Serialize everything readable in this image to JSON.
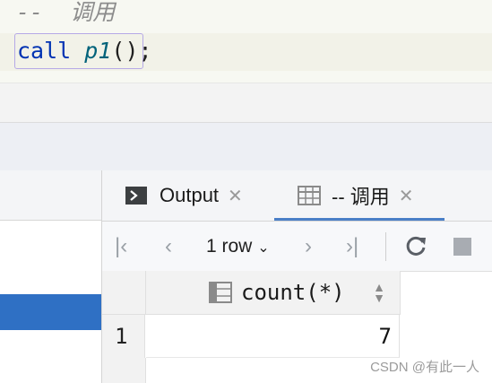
{
  "editor": {
    "comment_line": "--  调用",
    "keyword": "call",
    "proc_name": "p1",
    "punct": "();"
  },
  "results": {
    "tabs": [
      {
        "label": "Output",
        "icon": "console-icon"
      },
      {
        "label": "-- 调用",
        "icon": "table-icon",
        "active": true
      }
    ],
    "toolbar": {
      "rows_label": "1 row",
      "buttons": [
        "first-page-icon",
        "previous-page-icon",
        "next-page-icon",
        "last-page-icon",
        "refresh-icon",
        "stop-icon"
      ]
    },
    "grid": {
      "columns": [
        "count(*)"
      ],
      "rows": [
        {
          "num": "1",
          "values": [
            "7"
          ]
        }
      ]
    }
  },
  "watermark": "CSDN @有此一人",
  "colors": {
    "selection": "#2f70c4",
    "active_tab_underline": "#4a7fc7",
    "statement_border": "#b6a9e6"
  }
}
